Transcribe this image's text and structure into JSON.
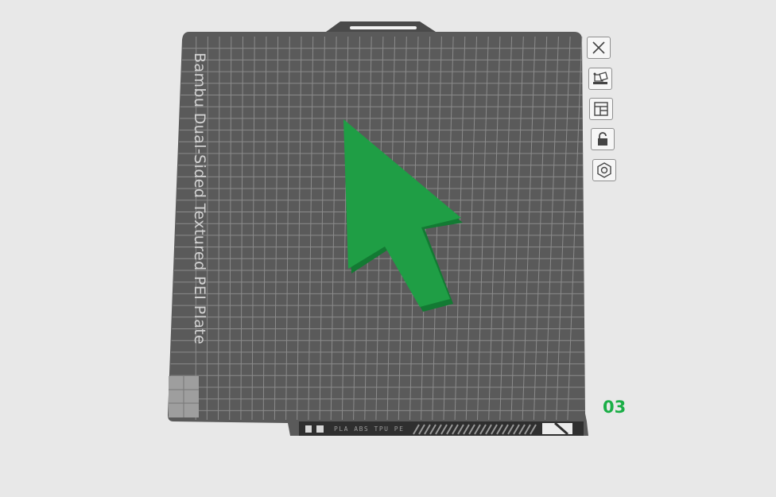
{
  "bed": {
    "label": "Bambu Dual-Sided Textured PEI Plate",
    "filament_strip": "PLA ABS TPU PE",
    "plate_number": "03"
  },
  "toolbar": {
    "items": [
      {
        "name": "close-button",
        "icon": "close-icon"
      },
      {
        "name": "arrange-button",
        "icon": "auto-arrange-icon"
      },
      {
        "name": "layout-button",
        "icon": "layout-icon"
      },
      {
        "name": "lock-button",
        "icon": "lock-icon"
      },
      {
        "name": "settings-button",
        "icon": "hex-settings-icon"
      }
    ]
  },
  "colors": {
    "background": "#e8e8e8",
    "bed": "#5a5a5a",
    "grid": "#8a8a8a",
    "model": "#1f9e45",
    "accent": "#1aae46"
  }
}
